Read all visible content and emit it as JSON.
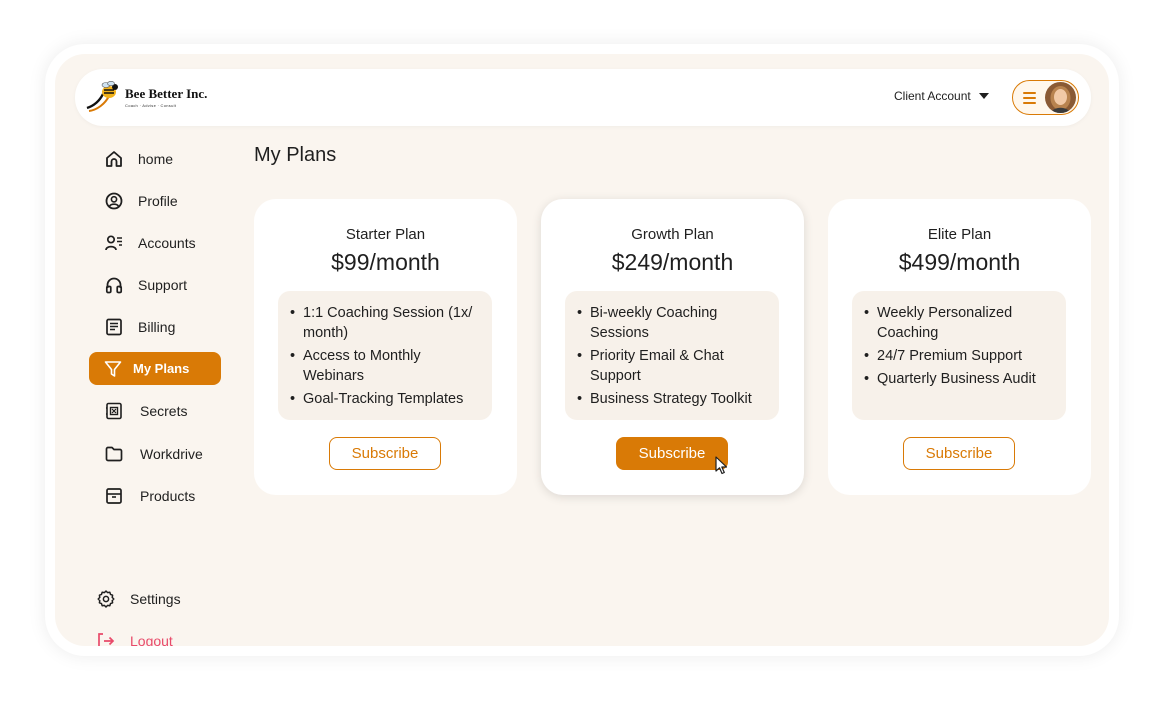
{
  "brand": {
    "name": "Bee Better Inc.",
    "tagline": "Coach · Advise · Consult"
  },
  "header": {
    "account_label": "Client Account"
  },
  "sidebar": {
    "items": [
      {
        "label": "home",
        "icon": "home-icon"
      },
      {
        "label": "Profile",
        "icon": "profile-icon"
      },
      {
        "label": "Accounts",
        "icon": "accounts-icon"
      },
      {
        "label": "Support",
        "icon": "headphones-icon"
      },
      {
        "label": "Billing",
        "icon": "billing-icon"
      },
      {
        "label": "My Plans",
        "icon": "filter-icon",
        "active": true
      },
      {
        "label": "Secrets",
        "icon": "safe-icon"
      },
      {
        "label": "Workdrive",
        "icon": "folder-icon"
      },
      {
        "label": "Products",
        "icon": "archive-icon"
      }
    ],
    "settings_label": "Settings",
    "logout_label": "Logout"
  },
  "main": {
    "title": "My Plans",
    "plans": [
      {
        "name": "Starter Plan",
        "price": "$99/month",
        "features": [
          "1:1 Coaching Session (1x/ month)",
          "Access to Monthly Webinars",
          "Goal-Tracking Templates"
        ],
        "button": "Subscribe"
      },
      {
        "name": "Growth Plan",
        "price": "$249/month",
        "features": [
          "Bi-weekly Coaching Sessions",
          "Priority Email & Chat Support",
          "Business Strategy Toolkit"
        ],
        "button": "Subscribe",
        "highlighted": true
      },
      {
        "name": "Elite Plan",
        "price": "$499/month",
        "features": [
          "Weekly Personalized Coaching",
          "24/7 Premium Support",
          "Quarterly Business Audit"
        ],
        "button": "Subscribe"
      }
    ]
  },
  "colors": {
    "accent": "#d97a06",
    "background": "#faf5ef",
    "card": "#ffffff",
    "feature_box": "#f7f1ea",
    "logout": "#e84a6a"
  }
}
